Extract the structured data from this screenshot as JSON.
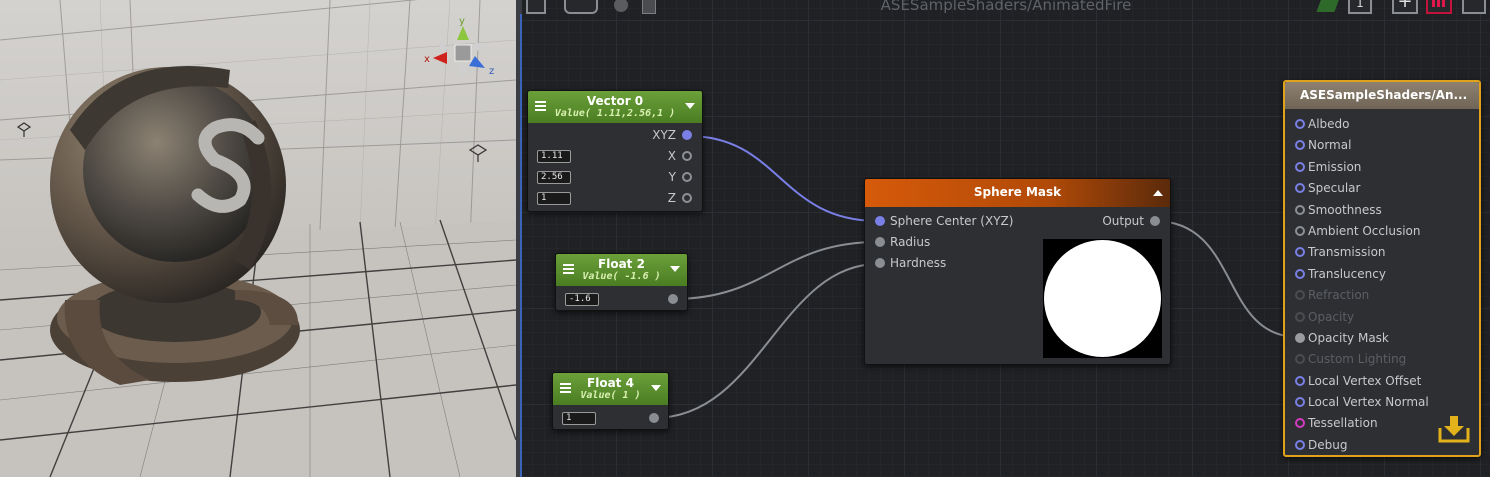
{
  "window": {
    "title": "ASESampleShaders/AnimatedFire",
    "toolbar_counter": "1"
  },
  "nodes": {
    "vector0": {
      "title": "Vector 0",
      "subtitle": "Value( 1.11,2.56,1 )",
      "out_port": "XYZ",
      "fields": [
        {
          "value": "1.11",
          "port": "X"
        },
        {
          "value": "2.56",
          "port": "Y"
        },
        {
          "value": "1",
          "port": "Z"
        }
      ]
    },
    "float2": {
      "title": "Float 2",
      "subtitle": "Value( -1.6 )",
      "field": "-1.6"
    },
    "float4": {
      "title": "Float 4",
      "subtitle": "Value( 1 )",
      "field": "1"
    },
    "sphere_mask": {
      "title": "Sphere Mask",
      "inputs": [
        "Sphere Center (XYZ)",
        "Radius",
        "Hardness"
      ],
      "output": "Output"
    },
    "output": {
      "title": "ASESampleShaders/An...",
      "ports": [
        {
          "label": "Albedo",
          "state": "blue"
        },
        {
          "label": "Normal",
          "state": "blue"
        },
        {
          "label": "Emission",
          "state": "blue"
        },
        {
          "label": "Specular",
          "state": "blue"
        },
        {
          "label": "Smoothness",
          "state": "gray"
        },
        {
          "label": "Ambient Occlusion",
          "state": "gray"
        },
        {
          "label": "Transmission",
          "state": "blue"
        },
        {
          "label": "Translucency",
          "state": "blue"
        },
        {
          "label": "Refraction",
          "state": "dim"
        },
        {
          "label": "Opacity",
          "state": "dim"
        },
        {
          "label": "Opacity Mask",
          "state": "connected"
        },
        {
          "label": "Custom Lighting",
          "state": "dim"
        },
        {
          "label": "Local Vertex Offset",
          "state": "blue"
        },
        {
          "label": "Local Vertex Normal",
          "state": "blue"
        },
        {
          "label": "Tessellation",
          "state": "pink"
        },
        {
          "label": "Debug",
          "state": "blue"
        }
      ]
    }
  },
  "gizmo": {
    "x": "x",
    "y": "y",
    "z": "z"
  },
  "colors": {
    "accent": "#e0a21a",
    "wire_blue": "#7a7fe6",
    "wire_gray": "#8a8d92"
  }
}
